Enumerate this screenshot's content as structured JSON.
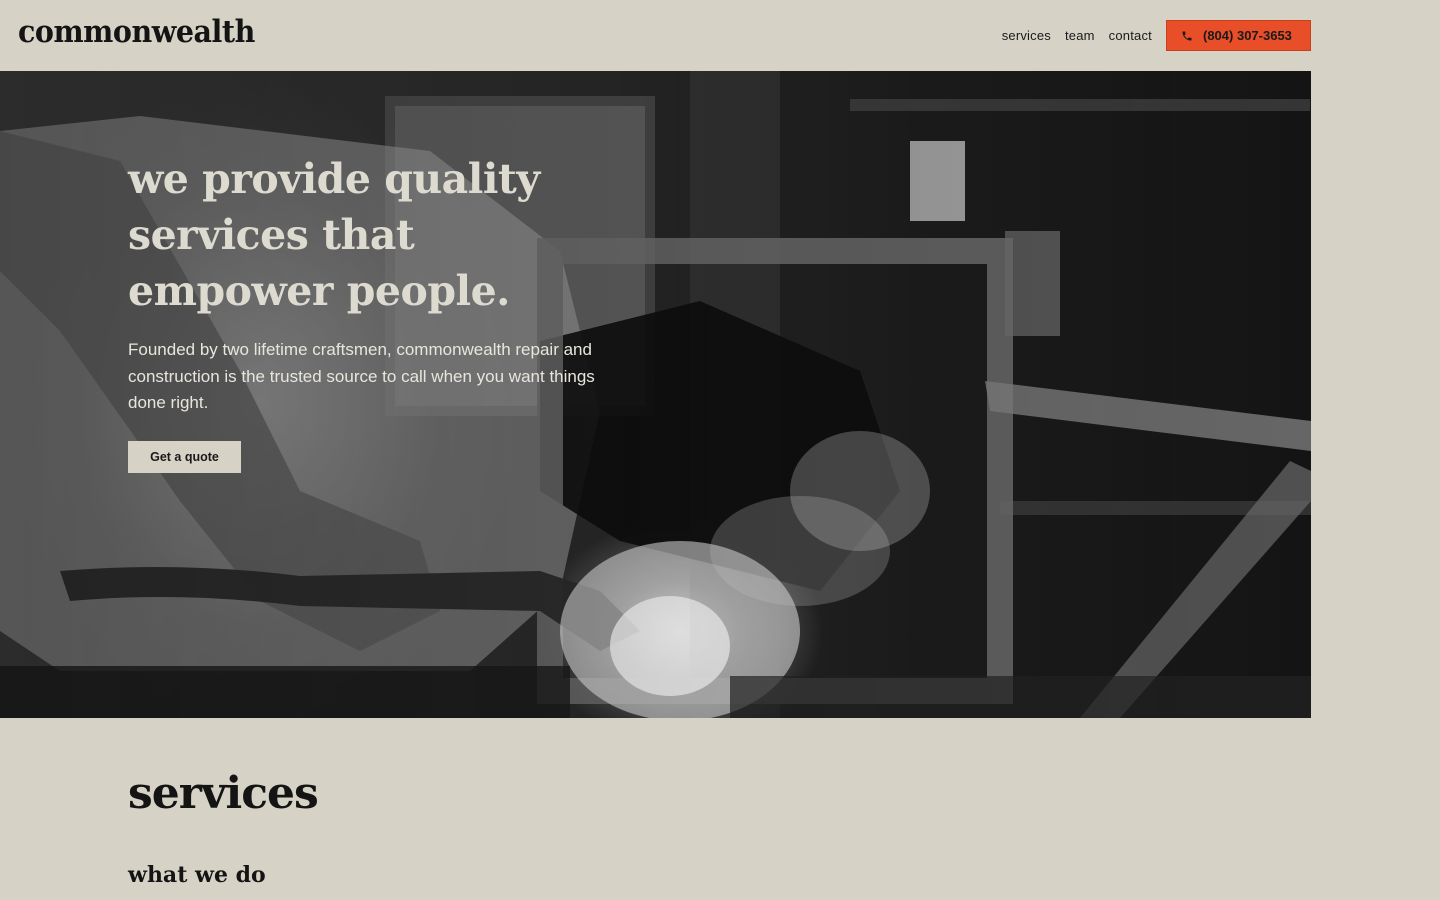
{
  "header": {
    "logo": "commonwealth",
    "nav": [
      {
        "label": "services"
      },
      {
        "label": "team"
      },
      {
        "label": "contact"
      }
    ],
    "phone": {
      "label": "(804) 307-3653",
      "icon": "phone-icon"
    }
  },
  "hero": {
    "title": "we provide quality services that empower people.",
    "description": "Founded by two lifetime craftsmen, commonwealth repair and construction is the trusted source to call when you want things done right.",
    "cta": "Get a quote"
  },
  "services": {
    "title": "services",
    "subtitle": "what we do"
  },
  "colors": {
    "background": "#d6d3c6",
    "accent": "#e84e28",
    "text": "#141414"
  }
}
